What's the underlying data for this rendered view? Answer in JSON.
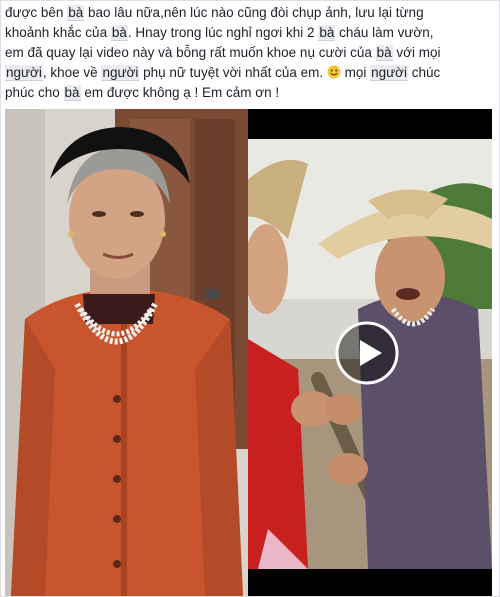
{
  "post": {
    "segments": [
      [
        "được bên ",
        {
          "tag": "bà"
        },
        " bao lâu nữa,nên lúc nào cũng đòi chụp ảnh, lưu lại từng"
      ],
      [
        "khoảnh khắc của ",
        {
          "tag": "bà"
        },
        ". Hnay trong lúc nghỉ ngơi khi 2 ",
        {
          "tag": "bà"
        },
        " cháu làm vườn,"
      ],
      [
        "em đã quay lại video này và bỗng rất muốn khoe nụ cười của ",
        {
          "tag": "bà"
        },
        " với mọi"
      ],
      [
        {
          "tag": "người"
        },
        ", khoe về ",
        {
          "tag": "người"
        },
        " phụ nữ tuyệt vời nhất của em. ",
        {
          "emoji": "smile-icon"
        },
        " mọi ",
        {
          "tag": "người"
        },
        " chúc"
      ],
      [
        "phúc cho ",
        {
          "tag": "bà"
        },
        " em được không ạ ! Em cảm ơn !"
      ]
    ]
  },
  "media": {
    "left_photo": {
      "alt": ""
    },
    "right_video": {
      "has_play_button": true
    }
  },
  "colors": {
    "text": "#1d2129",
    "tag_bg": "#e9ebee",
    "sweater": "#c8552e",
    "video_bg": "#000000",
    "emoji": "#f5c33b"
  }
}
